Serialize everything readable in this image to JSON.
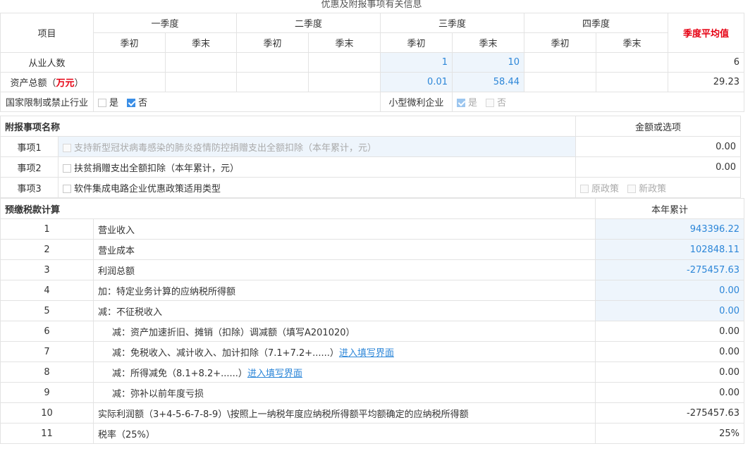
{
  "page_title": "优惠及附报事项有关信息",
  "quarter_table": {
    "item_label": "项目",
    "quarters": [
      "一季度",
      "二季度",
      "三季度",
      "四季度"
    ],
    "sub_begin": "季初",
    "sub_end": "季末",
    "avg_label": "季度平均值",
    "rows": [
      {
        "label": "从业人数",
        "q3_begin": "1",
        "q3_end": "10",
        "avg": "6"
      },
      {
        "label_main": "资产总额（",
        "label_unit": "万元",
        "label_tail": "）",
        "q3_begin": "0.01",
        "q3_end": "58.44",
        "avg": "29.23"
      }
    ],
    "restricted": {
      "label": "国家限制或禁止行业",
      "yes": "是",
      "no": "否"
    },
    "small": {
      "label": "小型微利企业",
      "yes": "是",
      "no": "否"
    }
  },
  "attach_table": {
    "header_name": "附报事项名称",
    "header_value": "金额或选项",
    "items": [
      {
        "label": "事项1",
        "text": "支持新型冠状病毒感染的肺炎疫情防控捐赠支出全额扣除（本年累计，元）",
        "value": "0.00"
      },
      {
        "label": "事项2",
        "text": "扶贫捐赠支出全额扣除（本年累计，元）",
        "value": "0.00"
      },
      {
        "label": "事项3",
        "text": "软件集成电路企业优惠政策适用类型",
        "opt1": "原政策",
        "opt2": "新政策"
      }
    ]
  },
  "prepay_table": {
    "header_name": "预缴税款计算",
    "header_value": "本年累计",
    "link_text": "进入填写界面",
    "rows": [
      {
        "no": "1",
        "text": "营业收入",
        "value": "943396.22"
      },
      {
        "no": "2",
        "text": "营业成本",
        "value": "102848.11"
      },
      {
        "no": "3",
        "text": "利润总额",
        "value": "-275457.63"
      },
      {
        "no": "4",
        "text": "加：特定业务计算的应纳税所得额",
        "value": "0.00"
      },
      {
        "no": "5",
        "text": "减：不征税收入",
        "value": "0.00"
      },
      {
        "no": "6",
        "text": "减：资产加速折旧、摊销（扣除）调减额（填写A201020）",
        "value": "0.00"
      },
      {
        "no": "7",
        "text": "减：免税收入、减计收入、加计扣除（7.1+7.2+......）",
        "value": "0.00"
      },
      {
        "no": "8",
        "text": "减：所得减免（8.1+8.2+......）",
        "value": "0.00"
      },
      {
        "no": "9",
        "text": "减：弥补以前年度亏损",
        "value": "0.00"
      },
      {
        "no": "10",
        "text": "实际利润额（3+4-5-6-7-8-9）\\按照上一纳税年度应纳税所得额平均额确定的应纳税所得额",
        "value": "-275457.63"
      },
      {
        "no": "11",
        "text": "税率（25%）",
        "value": "25%"
      }
    ]
  }
}
